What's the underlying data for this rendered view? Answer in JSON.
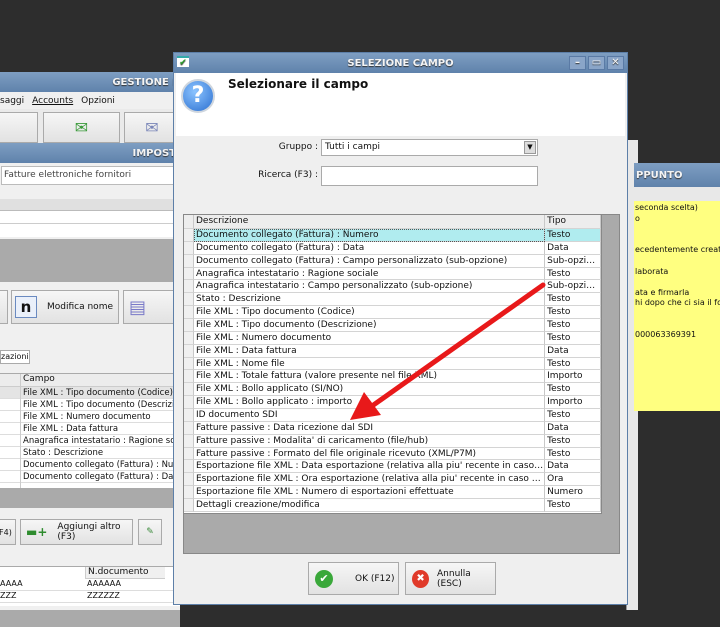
{
  "main_window": {
    "title": "GESTIONE I",
    "menu": [
      "saggi",
      "Accounts",
      "Opzioni"
    ]
  },
  "settings_window": {
    "title": "IMPOST",
    "filter_value": "Fatture elettroniche fornitori",
    "modify_name_label": "Modifica nome",
    "n_glyph": "n",
    "tab_label": "zazioni",
    "column_header": "Campo",
    "fields": [
      "File XML : Tipo documento (Codice)",
      "File XML : Tipo documento (Descrizione)",
      "File XML : Numero documento",
      "File XML : Data fattura",
      "Anagrafica intestatario : Ragione sociale",
      "Stato : Descrizione",
      "Documento collegato (Fattura) : Numero",
      "Documento collegato (Fattura) : Data"
    ],
    "f4_label": "F4)",
    "add_other_label": "Aggiungi altro (F3)",
    "bottom_header": "N.documento",
    "bottom_rows": [
      [
        "AAAA",
        "AAAAAA"
      ],
      [
        "ZZZ",
        "ZZZZZZ"
      ]
    ]
  },
  "note_window": {
    "title": "PPUNTO",
    "lines": [
      "seconda scelta)",
      "o",
      "",
      "",
      "ecedentemente creata",
      "",
      "laborata",
      "",
      "ata e firmarla",
      "hi dopo che ci sia il fog",
      "",
      "",
      "000063369391"
    ]
  },
  "dialog": {
    "title": "SELEZIONE CAMPO",
    "heading": "Selezionare il campo",
    "group_label": "Gruppo :",
    "group_value": "Tutti i campi",
    "search_label": "Ricerca (F3) :",
    "search_value": "",
    "columns": [
      "Descrizione",
      "Tipo"
    ],
    "rows": [
      [
        "Documento collegato (Fattura) : Numero",
        "Testo"
      ],
      [
        "Documento collegato (Fattura) : Data",
        "Data"
      ],
      [
        "Documento collegato (Fattura) : Campo personalizzato (sub-opzione)",
        "Sub-opzione"
      ],
      [
        "Anagrafica intestatario : Ragione sociale",
        "Testo"
      ],
      [
        "Anagrafica intestatario : Campo personalizzato (sub-opzione)",
        "Sub-opzione"
      ],
      [
        "Stato : Descrizione",
        "Testo"
      ],
      [
        "File XML : Tipo documento (Codice)",
        "Testo"
      ],
      [
        "File XML : Tipo documento (Descrizione)",
        "Testo"
      ],
      [
        "File XML : Numero documento",
        "Testo"
      ],
      [
        "File XML : Data fattura",
        "Data"
      ],
      [
        "File XML : Nome file",
        "Testo"
      ],
      [
        "File XML : Totale fattura (valore presente nel file XML)",
        "Importo"
      ],
      [
        "File XML : Bollo applicato (SI/NO)",
        "Testo"
      ],
      [
        "File XML : Bollo applicato : importo",
        "Importo"
      ],
      [
        "ID documento SDI",
        "Testo"
      ],
      [
        "Fatture passive : Data ricezione dal SDI",
        "Data"
      ],
      [
        "Fatture passive : Modalita' di caricamento (file/hub)",
        "Testo"
      ],
      [
        "Fatture passive : Formato del file originale ricevuto (XML/P7M)",
        "Testo"
      ],
      [
        "Esportazione file XML : Data esportazione (relativa alla piu' recente in caso di esportazioni multiple)",
        "Data"
      ],
      [
        "Esportazione file XML : Ora esportazione (relativa alla piu' recente in caso di esportazioni multiple)",
        "Ora"
      ],
      [
        "Esportazione file XML : Numero di esportazioni effettuate",
        "Numero"
      ],
      [
        "Dettagli creazione/modifica",
        "Testo"
      ]
    ],
    "ok_label": "OK (F12)",
    "cancel_label": "Annulla (ESC)",
    "selected_color": "#b0ecef",
    "arrow_color": "#e8191a"
  }
}
